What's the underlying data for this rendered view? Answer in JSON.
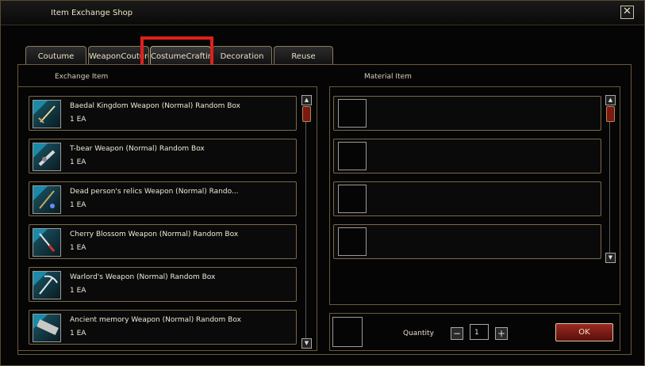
{
  "window": {
    "title": "Item Exchange Shop"
  },
  "tabs": [
    {
      "label": "Coutume"
    },
    {
      "label": "WeaponCouture"
    },
    {
      "label": "CostumeCrafting"
    },
    {
      "label": "Decoration"
    },
    {
      "label": "Reuse"
    }
  ],
  "active_tab": "CostumeCrafting",
  "exchange": {
    "label": "Exchange Item",
    "items": [
      {
        "name": "Baedal Kingdom Weapon (Normal) Random Box",
        "qty": "1 EA",
        "icon": "sword-icon"
      },
      {
        "name": "T-bear Weapon (Normal) Random Box",
        "qty": "1 EA",
        "icon": "gun-icon"
      },
      {
        "name": "Dead person's relics Weapon (Normal) Rando...",
        "qty": "1 EA",
        "icon": "staff-icon"
      },
      {
        "name": "Cherry Blossom Weapon (Normal) Random Box",
        "qty": "1 EA",
        "icon": "blade-icon"
      },
      {
        "name": "Warlord's Weapon (Normal) Random Box",
        "qty": "1 EA",
        "icon": "pickaxe-icon"
      },
      {
        "name": "Ancient memory Weapon (Normal) Random Box",
        "qty": "1 EA",
        "icon": "cannon-icon"
      }
    ]
  },
  "material": {
    "label": "Material Item",
    "slots": 4
  },
  "footer": {
    "quantity_label": "Quantity",
    "quantity_value": "1",
    "minus": "−",
    "plus": "+",
    "ok_label": "OK"
  },
  "close_glyph": "✕",
  "colors": {
    "highlight": "#e0201c",
    "ok_button": "#8a2018",
    "border_gold": "#6a5a3a"
  }
}
